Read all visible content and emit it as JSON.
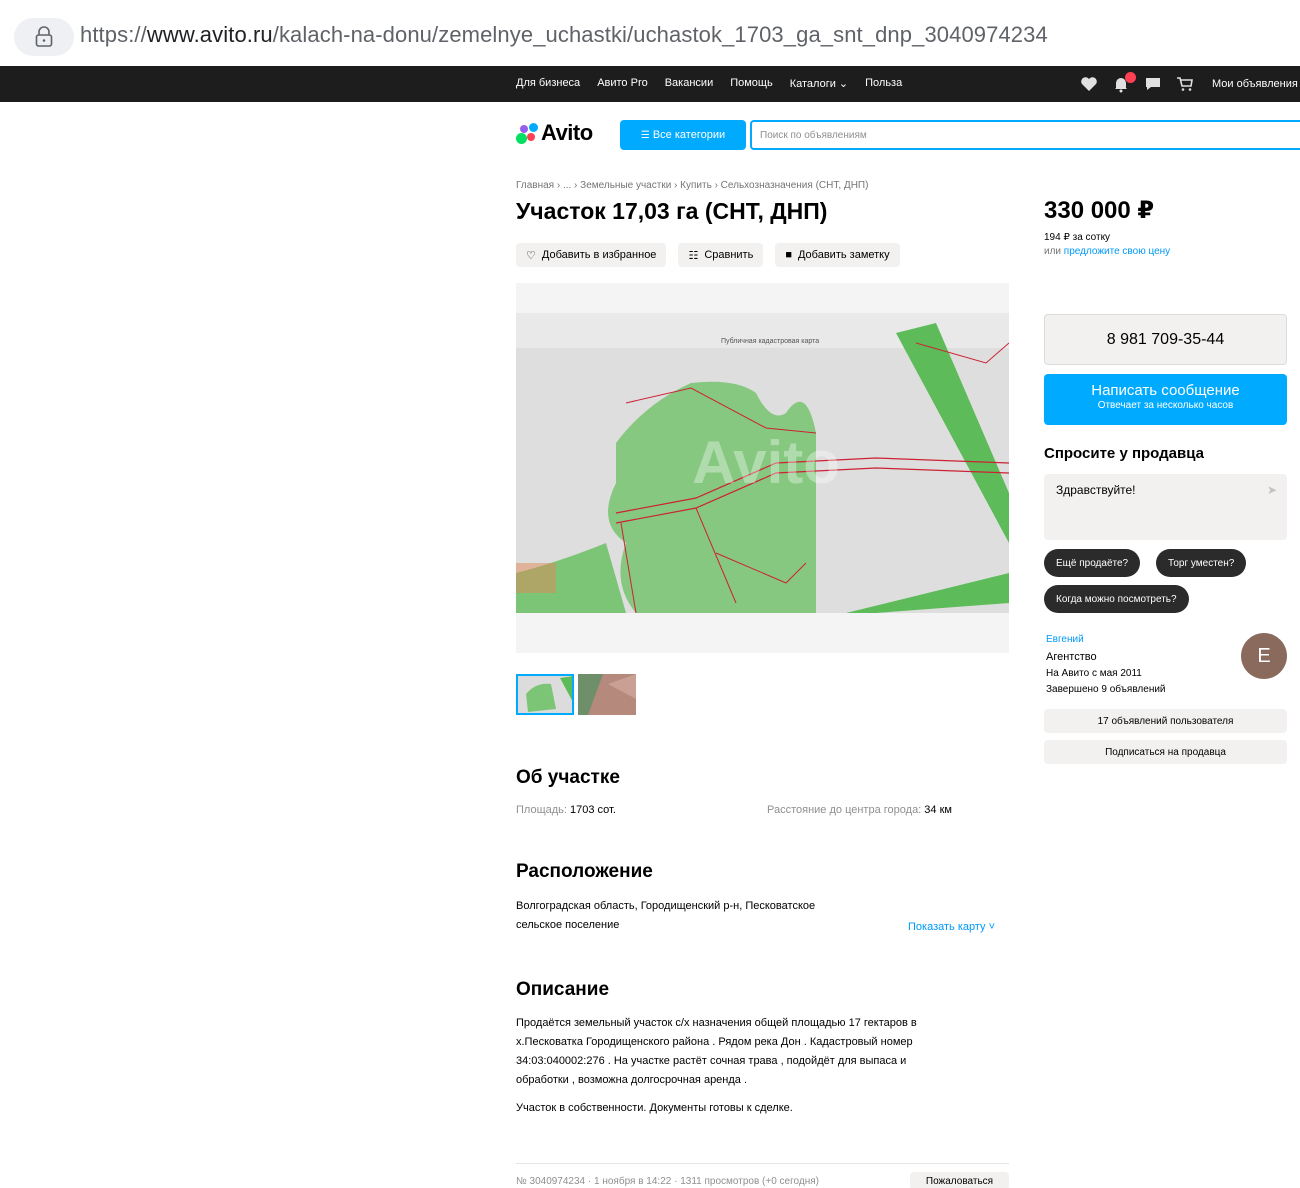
{
  "browser": {
    "url_prefix": "https://",
    "url_host": "www.avito.ru",
    "url_path": "/kalach-na-donu/zemelnye_uchastki/uchastok_1703_ga_snt_dnp_3040974234"
  },
  "topnav": {
    "links": [
      "Для бизнеса",
      "Авито Pro",
      "Вакансии",
      "Помощь",
      "Каталоги ⌄",
      "Польза"
    ],
    "my_ads": "Мои объявления"
  },
  "header": {
    "logo": "Avito",
    "categories_button": "Все категории",
    "search_placeholder": "Поиск по объявлениям"
  },
  "breadcrumbs": "Главная › ... › Земельные участки › Купить › Сельхозназначения (СНТ, ДНП)",
  "title": "Участок 17,03 га (СНТ, ДНП)",
  "actions": {
    "favorite": "Добавить в избранное",
    "compare": "Сравнить",
    "note": "Добавить заметку"
  },
  "photo": {
    "map_caption": "Публичная кадастровая карта",
    "watermark": "Avito",
    "thumbnail_count": 2
  },
  "about": {
    "heading": "Об участке",
    "area_label": "Площадь: ",
    "area_value": "1703 сот.",
    "distance_label": "Расстояние до центра города: ",
    "distance_value": "34 км"
  },
  "location": {
    "heading": "Расположение",
    "address_line1": "Волгоградская область, Городищенский р-н, Песковатское",
    "address_line2": "сельское поселение",
    "show_map": "Показать карту ˅"
  },
  "description": {
    "heading": "Описание",
    "lines": [
      "Продаётся земельный участок с/х назначения общей площадью 17 гектаров в",
      "х.Песковатка Городищенского района . Рядом река Дон . Кадастровый номер",
      "34:03:040002:276 . На участке растёт сочная трава , подойдёт для выпаса и",
      "обработки , возможна долгосрочная аренда ."
    ],
    "paragraph2": "Участок в собственности. Документы готовы к сделке."
  },
  "footer": {
    "meta": "№ 3040974234 · 1 ноября в 14:22 · 1311 просмотров (+0 сегодня)",
    "complain": "Пожаловаться"
  },
  "sidebar": {
    "price": "330 000 ₽",
    "price_per_sotka": "194 ₽ за сотку",
    "offer_prefix": "или ",
    "offer_link": "предложите свою цену",
    "phone": "8 981 709-35-44",
    "write_title": "Написать сообщение",
    "write_subtitle": "Отвечает за несколько часов",
    "ask_heading": "Спросите у продавца",
    "ask_value": "Здравствуйте!",
    "chips": [
      "Ещё продаёте?",
      "Торг уместен?",
      "Когда можно посмотреть?"
    ],
    "seller": {
      "name": "Евгений",
      "type": "Агентство",
      "since": "На Авито с мая 2011",
      "done": "Завершено 9 объявлений",
      "avatar_letter": "E"
    },
    "user_ads": "17 объявлений пользователя",
    "subscribe": "Подписаться на продавца"
  },
  "colors": {
    "accent": "#00aaff",
    "link": "#0099f7",
    "topbar": "#1d1d1d",
    "avatar": "#8a6a5d"
  }
}
